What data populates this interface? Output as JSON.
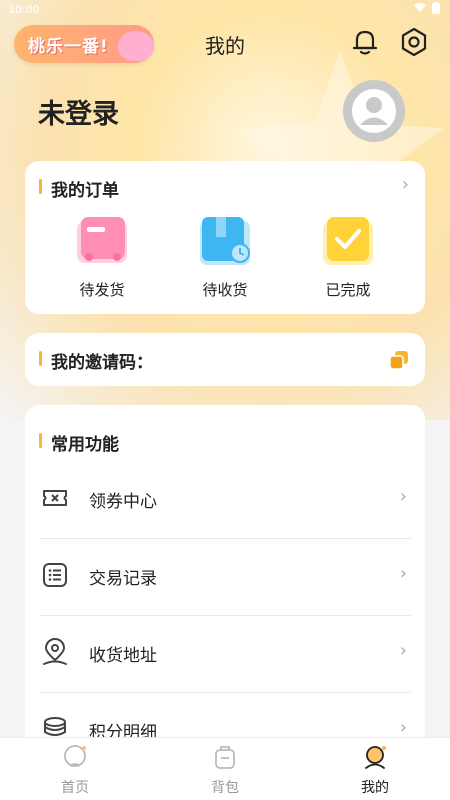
{
  "status": {
    "time": "10:00"
  },
  "logo": {
    "text": "桃乐一番!"
  },
  "header": {
    "title": "我的"
  },
  "profile": {
    "name": "未登录"
  },
  "orders": {
    "title": "我的订单",
    "items": [
      {
        "label": "待发货",
        "icon": "pending-ship-icon",
        "color": "#ff8fb3"
      },
      {
        "label": "待收货",
        "icon": "pending-receive-icon",
        "color": "#3fb6f2"
      },
      {
        "label": "已完成",
        "icon": "completed-icon",
        "color": "#ffd23a"
      }
    ]
  },
  "invite": {
    "title": "我的邀请码："
  },
  "functions": {
    "title": "常用功能",
    "items": [
      {
        "label": "领券中心",
        "icon": "coupon-icon"
      },
      {
        "label": "交易记录",
        "icon": "transaction-list-icon"
      },
      {
        "label": "收货地址",
        "icon": "location-icon"
      },
      {
        "label": "积分明细",
        "icon": "points-coins-icon"
      }
    ]
  },
  "tabs": [
    {
      "label": "首页",
      "icon": "home-icon"
    },
    {
      "label": "背包",
      "icon": "backpack-icon"
    },
    {
      "label": "我的",
      "icon": "mine-icon",
      "active": true
    }
  ],
  "colors": {
    "accent": "#f7b733",
    "background": "#f4f4f4"
  }
}
